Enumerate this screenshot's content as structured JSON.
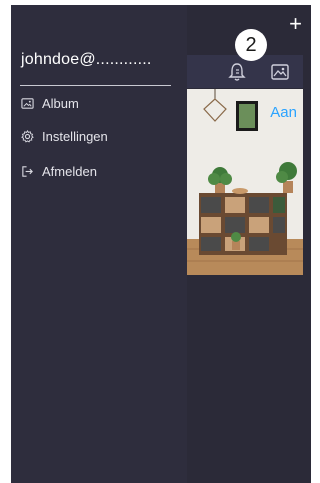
{
  "drawer": {
    "user": "johndoe@............",
    "menu": [
      {
        "label": "Album",
        "icon": "image-icon"
      },
      {
        "label": "Instellingen",
        "icon": "gear-icon"
      },
      {
        "label": "Afmelden",
        "icon": "sign-out-icon"
      }
    ]
  },
  "header": {
    "add_label": "+",
    "step_number": "2"
  },
  "thumbnail": {
    "status": "Aan"
  },
  "colors": {
    "panel": "#2e2d3d",
    "status_accent": "#2aa3ff"
  }
}
